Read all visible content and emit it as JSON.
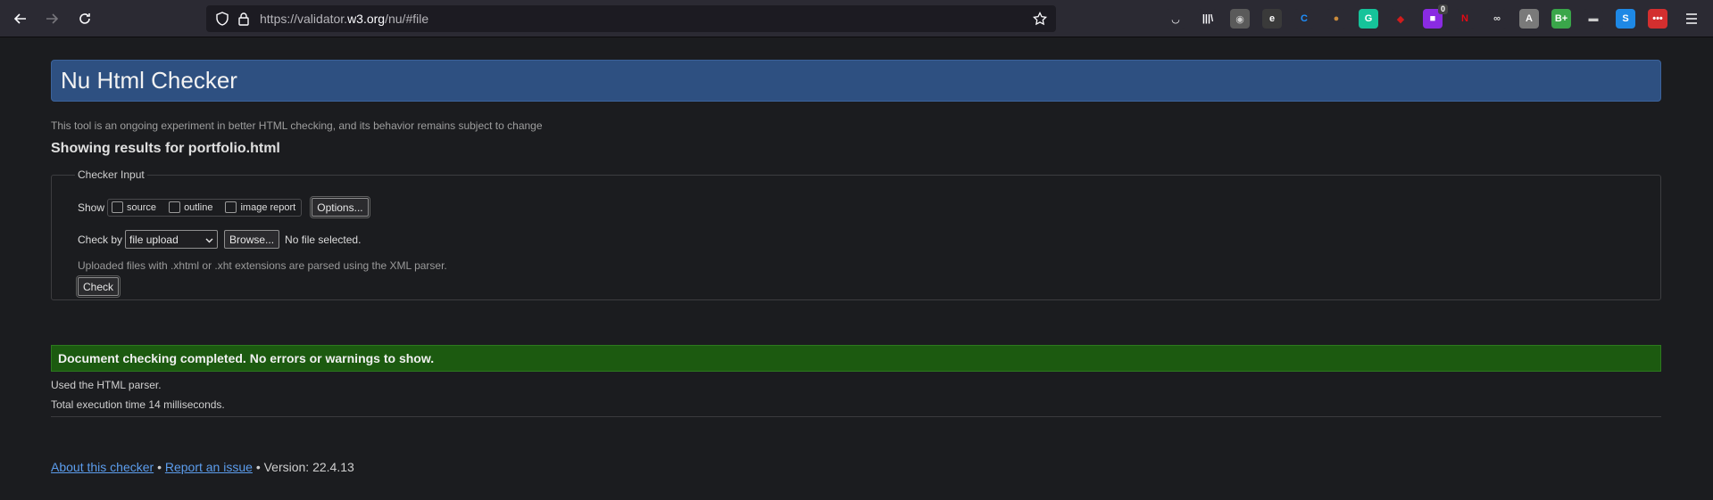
{
  "browser": {
    "url_prefix": "https://validator.",
    "url_host": "w3.org",
    "url_path": "/nu/#file",
    "extensions": [
      {
        "name": "pocket-icon",
        "glyph": "◡",
        "color": "#2b2a33",
        "fg": "#fbfbfe"
      },
      {
        "name": "library-icon",
        "glyph": "|||\\",
        "color": "#2b2a33",
        "fg": "#fbfbfe"
      },
      {
        "name": "profile-extension-icon",
        "glyph": "◉",
        "color": "#5a5a5a",
        "fg": "#cccccc"
      },
      {
        "name": "edge-extension-icon",
        "glyph": "e",
        "color": "#3a3a3a",
        "fg": "#ffffff"
      },
      {
        "name": "c-extension-icon",
        "glyph": "C",
        "color": "#2b2a33",
        "fg": "#1e90ff"
      },
      {
        "name": "cookie-extension-icon",
        "glyph": "●",
        "color": "#2b2a33",
        "fg": "#c98a3c"
      },
      {
        "name": "grammarly-icon",
        "glyph": "G",
        "color": "#15c39a",
        "fg": "#ffffff"
      },
      {
        "name": "red-shield-icon",
        "glyph": "◆",
        "color": "#2b2a33",
        "fg": "#d01c1c"
      },
      {
        "name": "purple-extension-icon",
        "glyph": "■",
        "color": "#8a2be2",
        "fg": "#ffffff",
        "badge": "0"
      },
      {
        "name": "netflix-icon",
        "glyph": "N",
        "color": "#2b2a33",
        "fg": "#e50914"
      },
      {
        "name": "glasses-extension-icon",
        "glyph": "∞",
        "color": "#2b2a33",
        "fg": "#dddddd"
      },
      {
        "name": "translate-extension-icon",
        "glyph": "A",
        "color": "#7a7a7a",
        "fg": "#ffffff"
      },
      {
        "name": "bplus-extension-icon",
        "glyph": "B+",
        "color": "#3aa64a",
        "fg": "#ffffff"
      },
      {
        "name": "tank-extension-icon",
        "glyph": "▬",
        "color": "#2b2a33",
        "fg": "#cccccc"
      },
      {
        "name": "s-extension-icon",
        "glyph": "S",
        "color": "#1e88e5",
        "fg": "#ffffff"
      },
      {
        "name": "red-dots-extension-icon",
        "glyph": "•••",
        "color": "#d32f2f",
        "fg": "#ffffff"
      }
    ]
  },
  "page": {
    "title": "Nu Html Checker",
    "tagline": "This tool is an ongoing experiment in better HTML checking, and its behavior remains subject to change",
    "results_heading": "Showing results for portfolio.html",
    "checker": {
      "legend": "Checker Input",
      "show_label": "Show",
      "options": [
        "source",
        "outline",
        "image report"
      ],
      "options_button": "Options...",
      "check_by_label": "Check by",
      "check_by_value": "file upload",
      "browse_button": "Browse...",
      "file_status": "No file selected.",
      "note": "Uploaded files with .xhtml or .xht extensions are parsed using the XML parser.",
      "check_button": "Check"
    },
    "success_message": "Document checking completed. No errors or warnings to show.",
    "parser_info": "Used the HTML parser.",
    "execution_time": "Total execution time 14 milliseconds.",
    "footer": {
      "about_link": "About this checker",
      "separator": "•",
      "report_link": "Report an issue",
      "version": "Version: 22.4.13"
    }
  }
}
